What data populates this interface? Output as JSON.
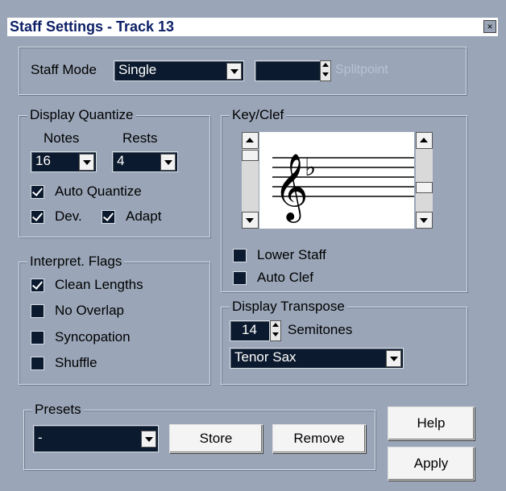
{
  "window": {
    "title": "Staff Settings - Track 13",
    "close_glyph": "×"
  },
  "staff_mode": {
    "label": "Staff Mode",
    "value": "Single",
    "splitpoint_value": "",
    "splitpoint_label": "Splitpoint"
  },
  "display_quantize": {
    "title": "Display Quantize",
    "notes_label": "Notes",
    "notes_value": "16",
    "rests_label": "Rests",
    "rests_value": "4",
    "auto_quantize": {
      "label": "Auto Quantize",
      "checked": true
    },
    "dev": {
      "label": "Dev.",
      "checked": true
    },
    "adapt": {
      "label": "Adapt",
      "checked": true
    }
  },
  "interpret_flags": {
    "title": "Interpret. Flags",
    "items": [
      {
        "label": "Clean Lengths",
        "checked": true
      },
      {
        "label": "No Overlap",
        "checked": false
      },
      {
        "label": "Syncopation",
        "checked": false
      },
      {
        "label": "Shuffle",
        "checked": false
      }
    ]
  },
  "key_clef": {
    "title": "Key/Clef",
    "clef_glyph": "𝄞",
    "key_glyph": "♭",
    "lower_staff": {
      "label": "Lower Staff",
      "checked": false
    },
    "auto_clef": {
      "label": "Auto Clef",
      "checked": false
    }
  },
  "display_transpose": {
    "title": "Display Transpose",
    "semitones_value": "14",
    "semitones_label": "Semitones",
    "instrument": "Tenor Sax"
  },
  "presets": {
    "title": "Presets",
    "value": "-",
    "store_label": "Store",
    "remove_label": "Remove"
  },
  "buttons": {
    "help_label": "Help",
    "apply_label": "Apply"
  }
}
